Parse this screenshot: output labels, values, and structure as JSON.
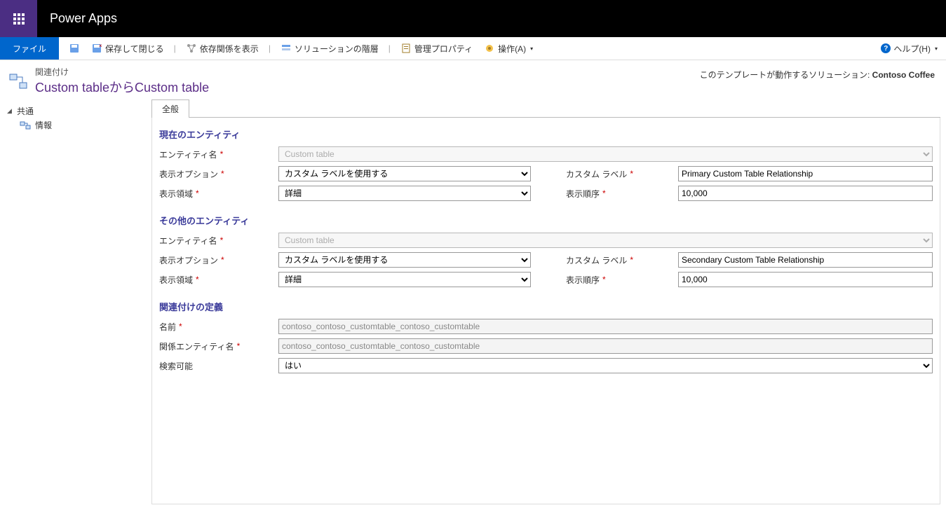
{
  "header": {
    "app_title": "Power Apps"
  },
  "toolbar": {
    "file": "ファイル",
    "save_close": "保存して閉じる",
    "show_deps": "依存関係を表示",
    "solution_layers": "ソリューションの階層",
    "managed_props": "管理プロパティ",
    "actions": "操作(A)",
    "help": "ヘルプ(H)"
  },
  "page": {
    "subtitle": "関連付け",
    "title": "Custom tableからCustom table",
    "solution_prefix": "このテンプレートが動作するソリューション: ",
    "solution_name": "Contoso Coffee"
  },
  "sidebar": {
    "root": "共通",
    "info": "情報"
  },
  "tabs": {
    "general": "全般"
  },
  "sections": {
    "current_entity": "現在のエンティティ",
    "other_entity": "その他のエンティティ",
    "rel_def": "関連付けの定義"
  },
  "labels": {
    "entity_name": "エンティティ名",
    "display_option": "表示オプション",
    "custom_label": "カスタム ラベル",
    "display_area": "表示領域",
    "display_order": "表示順序",
    "name": "名前",
    "rel_entity_name": "関係エンティティ名",
    "searchable": "検索可能"
  },
  "values": {
    "entity_name_current": "Custom table",
    "display_option_current": "カスタム ラベルを使用する",
    "custom_label_current": "Primary Custom Table Relationship",
    "display_area_current": "詳細",
    "display_order_current": "10,000",
    "entity_name_other": "Custom table",
    "display_option_other": "カスタム ラベルを使用する",
    "custom_label_other": "Secondary Custom Table Relationship",
    "display_area_other": "詳細",
    "display_order_other": "10,000",
    "name": "contoso_contoso_customtable_contoso_customtable",
    "rel_entity_name": "contoso_contoso_customtable_contoso_customtable",
    "searchable": "はい"
  }
}
